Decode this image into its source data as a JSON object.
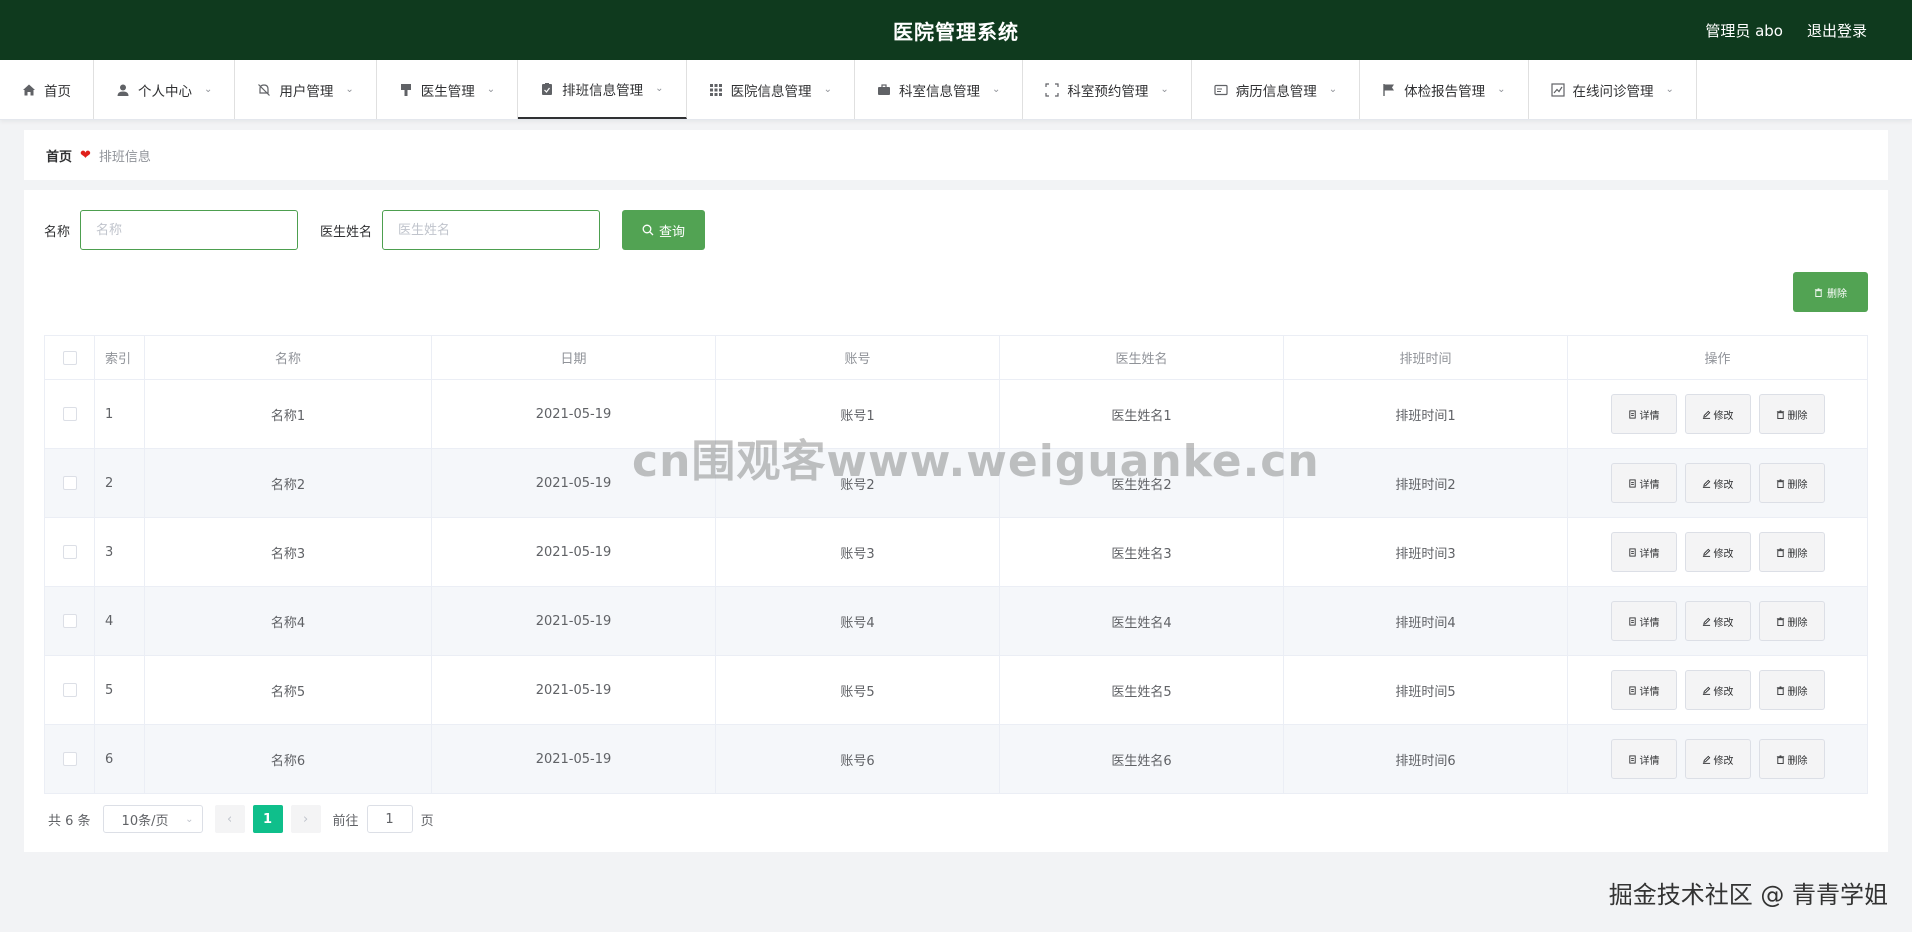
{
  "app": {
    "title": "医院管理系统",
    "user_label": "管理员 abo",
    "logout_label": "退出登录"
  },
  "menu": [
    {
      "label": "首页",
      "icon": "home-icon"
    },
    {
      "label": "个人中心",
      "icon": "user-icon"
    },
    {
      "label": "用户管理",
      "icon": "bell-off-icon"
    },
    {
      "label": "医生管理",
      "icon": "brush-icon"
    },
    {
      "label": "排班信息管理",
      "icon": "clipboard-icon",
      "active": true
    },
    {
      "label": "医院信息管理",
      "icon": "grid-icon"
    },
    {
      "label": "科室信息管理",
      "icon": "briefcase-icon"
    },
    {
      "label": "科室预约管理",
      "icon": "fullscreen-icon"
    },
    {
      "label": "病历信息管理",
      "icon": "id-card-icon"
    },
    {
      "label": "体检报告管理",
      "icon": "flag-icon"
    },
    {
      "label": "在线问诊管理",
      "icon": "chart-icon"
    }
  ],
  "breadcrumb": {
    "home": "首页",
    "current": "排班信息"
  },
  "search": {
    "name_label": "名称",
    "name_placeholder": "名称",
    "doctor_label": "医生姓名",
    "doctor_placeholder": "医生姓名",
    "query_label": "查询"
  },
  "delete_all_label": "删除",
  "table": {
    "headers": {
      "index": "索引",
      "name": "名称",
      "date": "日期",
      "account": "账号",
      "doctor": "医生姓名",
      "time": "排班时间",
      "ops": "操作"
    },
    "rows": [
      {
        "index": "1",
        "name": "名称1",
        "date": "2021-05-19",
        "account": "账号1",
        "doctor": "医生姓名1",
        "time": "排班时间1"
      },
      {
        "index": "2",
        "name": "名称2",
        "date": "2021-05-19",
        "account": "账号2",
        "doctor": "医生姓名2",
        "time": "排班时间2"
      },
      {
        "index": "3",
        "name": "名称3",
        "date": "2021-05-19",
        "account": "账号3",
        "doctor": "医生姓名3",
        "time": "排班时间3"
      },
      {
        "index": "4",
        "name": "名称4",
        "date": "2021-05-19",
        "account": "账号4",
        "doctor": "医生姓名4",
        "time": "排班时间4"
      },
      {
        "index": "5",
        "name": "名称5",
        "date": "2021-05-19",
        "account": "账号5",
        "doctor": "医生姓名5",
        "time": "排班时间5"
      },
      {
        "index": "6",
        "name": "名称6",
        "date": "2021-05-19",
        "account": "账号6",
        "doctor": "医生姓名6",
        "time": "排班时间6"
      }
    ],
    "op_labels": {
      "detail": "详情",
      "edit": "修改",
      "delete": "删除"
    }
  },
  "pager": {
    "total": "共 6 条",
    "page_size": "10条/页",
    "current_page": "1",
    "goto_label": "前往",
    "goto_value": "1",
    "page_suffix": "页"
  },
  "watermark": "cn围观客www.weiguanke.cn",
  "credit": "掘金技术社区 @ 青青学姐",
  "colors": {
    "topbar": "#0f3a1e",
    "accent": "#52a353",
    "active_page": "#0fbf8b"
  }
}
